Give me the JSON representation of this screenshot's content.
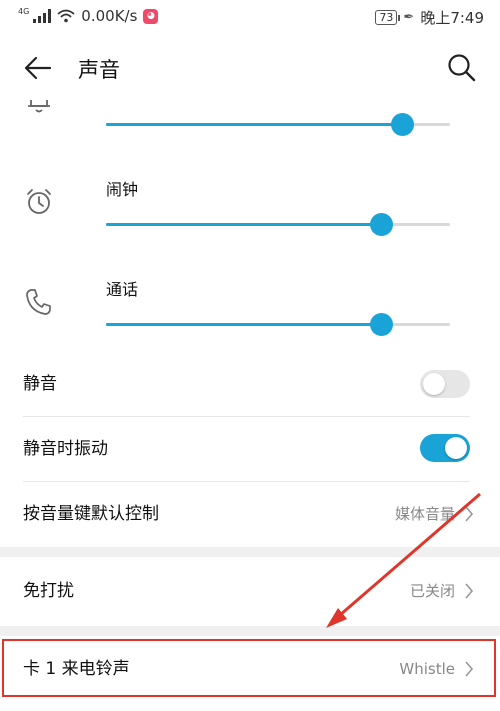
{
  "status_bar": {
    "network_type": "4G",
    "speed": "0.00K/s",
    "app_badge_icon": "app-notification-icon",
    "battery": "73",
    "time": "晚上7:49"
  },
  "header": {
    "title": "声音",
    "back_icon": "back-arrow-icon",
    "search_icon": "search-icon"
  },
  "volumes": [
    {
      "label": "",
      "icon": "bell-icon",
      "level": 0.86
    },
    {
      "label": "闹钟",
      "icon": "alarm-clock-icon",
      "level": 0.8
    },
    {
      "label": "通话",
      "icon": "phone-icon",
      "level": 0.8
    }
  ],
  "settings": {
    "mute": {
      "label": "静音",
      "on": false
    },
    "vibrate_on_mute": {
      "label": "静音时振动",
      "on": true
    },
    "volume_key_control": {
      "label": "按音量键默认控制",
      "value": "媒体音量"
    },
    "do_not_disturb": {
      "label": "免打扰",
      "value": "已关闭"
    },
    "sim1_ringtone": {
      "label": "卡 1 来电铃声",
      "value": "Whistle"
    }
  },
  "colors": {
    "accent": "#1aa3d6",
    "annotation": "#e0352b"
  }
}
